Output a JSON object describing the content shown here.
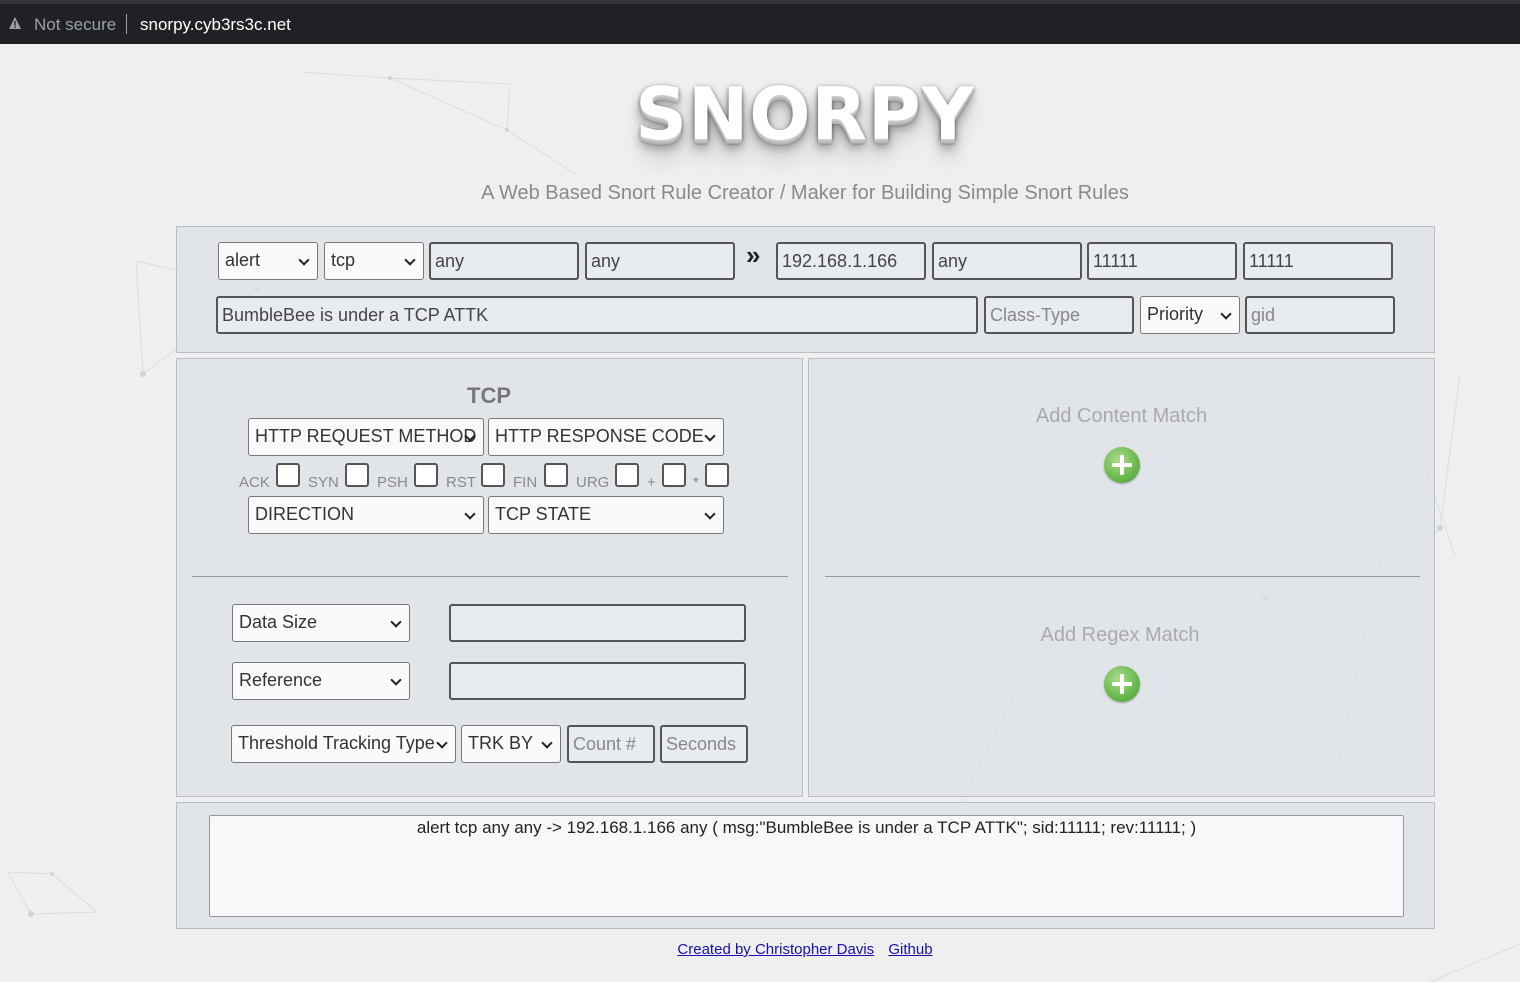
{
  "browser": {
    "security_label": "Not secure",
    "url": "snorpy.cyb3rs3c.net",
    "warning_icon": "warning-triangle-icon"
  },
  "header": {
    "title": "SNORPY",
    "subtitle": "A Web Based Snort Rule Creator / Maker for Building Simple Snort Rules"
  },
  "rule_header": {
    "action": "alert",
    "protocol": "tcp",
    "src_ip": "any",
    "src_port": "any",
    "direction_symbol": "»",
    "dst_ip": "192.168.1.166",
    "dst_port": "any",
    "sid": "11111",
    "rev": "11111",
    "message": "BumbleBee is under a TCP ATTK",
    "class_type_placeholder": "Class-Type",
    "priority": "Priority",
    "gid_placeholder": "gid"
  },
  "tcp_panel": {
    "title": "TCP",
    "http_request_method": "HTTP REQUEST METHOD",
    "http_response_code": "HTTP RESPONSE CODE",
    "flags": [
      {
        "label": "ACK",
        "checked": false
      },
      {
        "label": "SYN",
        "checked": false
      },
      {
        "label": "PSH",
        "checked": false
      },
      {
        "label": "RST",
        "checked": false
      },
      {
        "label": "FIN",
        "checked": false
      },
      {
        "label": "URG",
        "checked": false
      },
      {
        "label": "+",
        "checked": false
      },
      {
        "label": "*",
        "checked": false
      }
    ],
    "direction": "DIRECTION",
    "tcp_state": "TCP STATE",
    "data_size": "Data Size",
    "data_size_value": "",
    "reference": "Reference",
    "reference_value": "",
    "threshold_tracking_type": "Threshold Tracking Type",
    "track_by": "TRK BY",
    "count_placeholder": "Count #",
    "seconds_placeholder": "Seconds"
  },
  "match_panel": {
    "content_label": "Add Content Match",
    "regex_label": "Add Regex Match",
    "add_icon": "plus-circle-icon"
  },
  "output": {
    "rule_text": "alert tcp any any -> 192.168.1.166 any ( msg:\"BumbleBee is under a TCP ATTK\";  sid:11111; rev:11111; )"
  },
  "footer": {
    "credit_link": "Created by Christopher Davis",
    "github_link": "Github"
  }
}
